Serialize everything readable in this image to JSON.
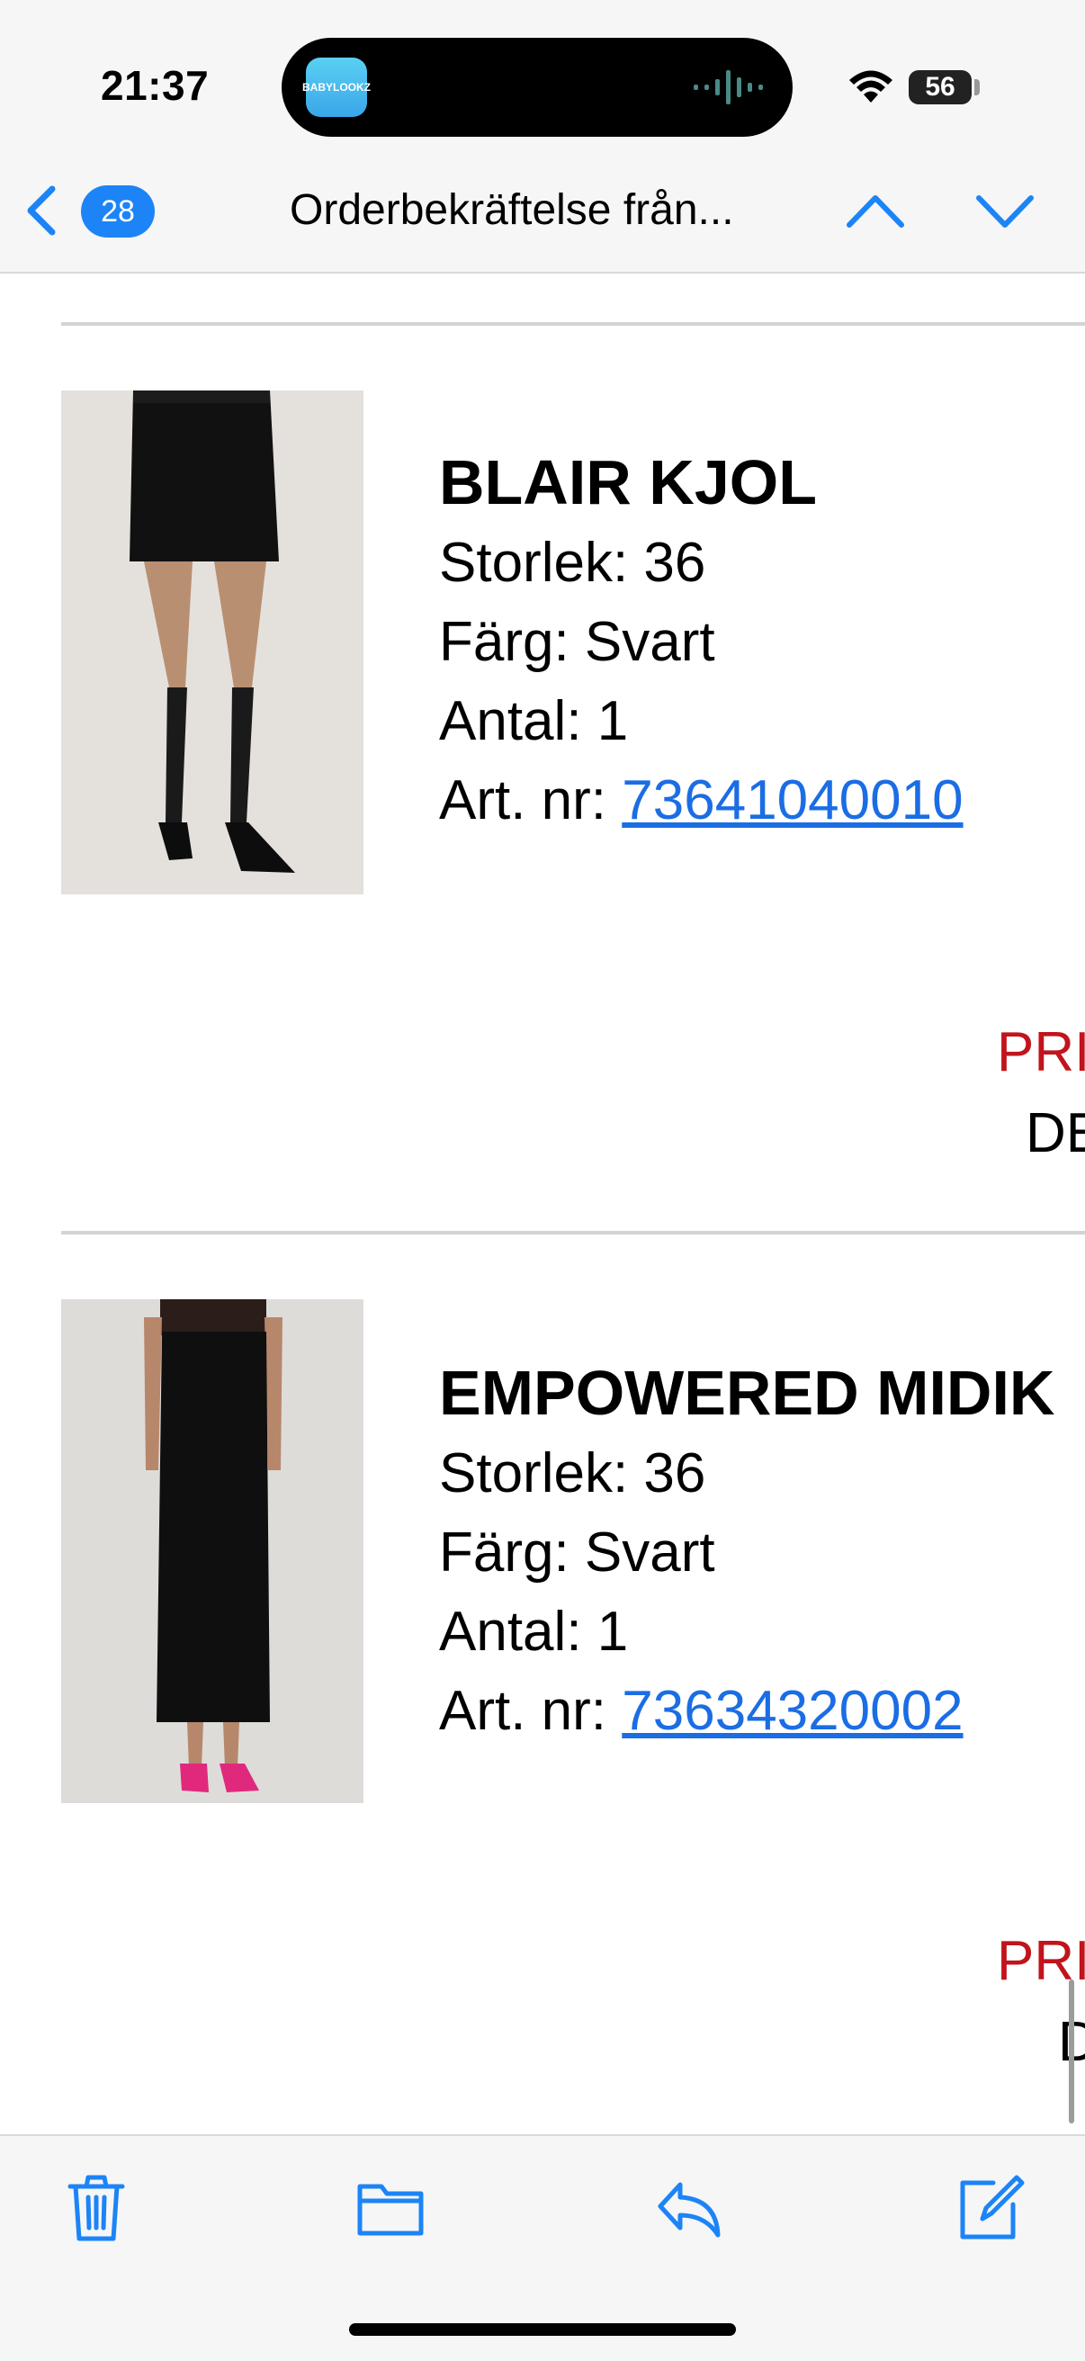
{
  "status": {
    "time": "21:37",
    "battery": "56"
  },
  "island": {
    "app_label": "BABYLOOKZ"
  },
  "nav": {
    "unread_count": "28",
    "title": "Orderbekräftelse från..."
  },
  "colors": {
    "accent": "#1c84f7",
    "link": "#1b6de4",
    "price_red": "#c1141c"
  },
  "products": [
    {
      "name": "BLAIR KJOL",
      "size": "Storlek: 36",
      "color": "Färg: Svart",
      "qty": "Antal: 1",
      "art_label": "Art. nr: ",
      "art_no": "73641040010",
      "price_label": "PRI",
      "sub_label": "DE"
    },
    {
      "name": "EMPOWERED MIDIK",
      "size": "Storlek: 36",
      "color": "Färg: Svart",
      "qty": "Antal: 1",
      "art_label": "Art. nr: ",
      "art_no": "73634320002",
      "price_label": "PRI",
      "sub_label": "D"
    }
  ],
  "toolbar": {
    "icons": [
      "trash-icon",
      "folder-icon",
      "reply-icon",
      "compose-icon"
    ]
  }
}
